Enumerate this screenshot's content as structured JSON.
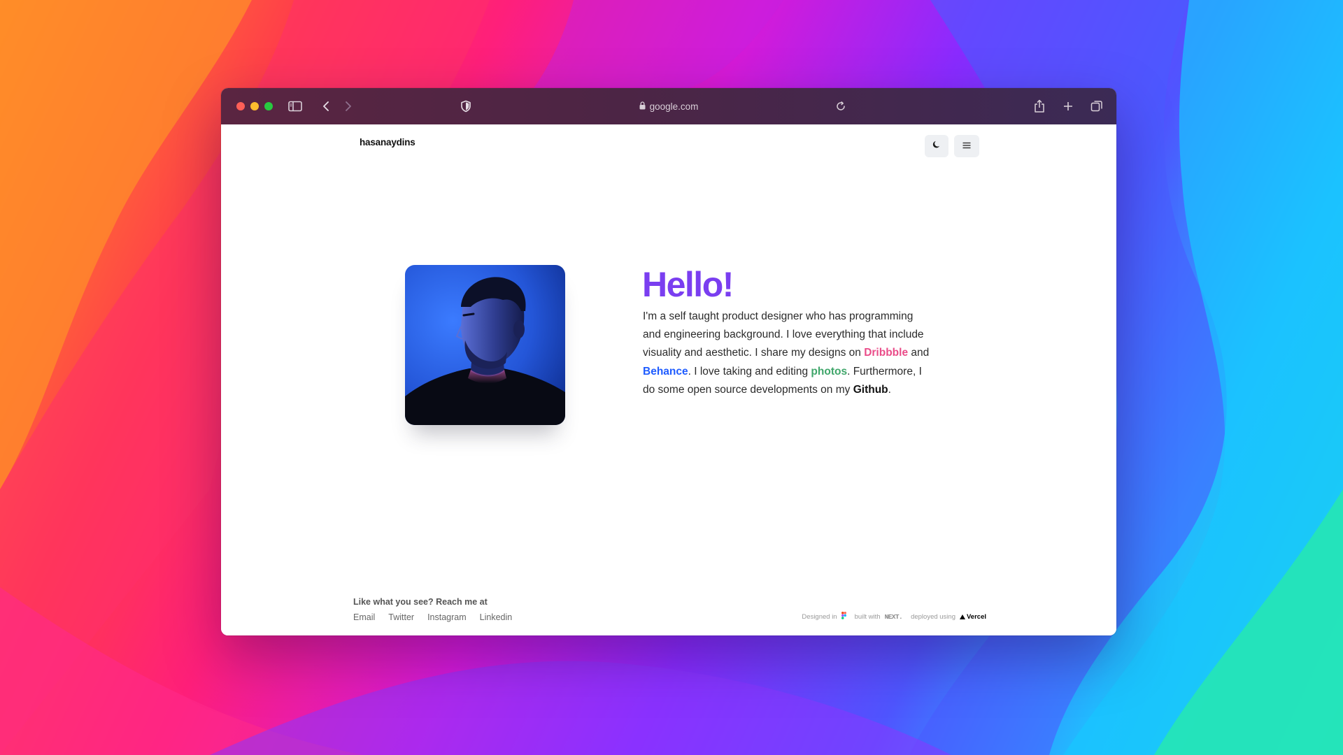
{
  "browser": {
    "url": "google.com",
    "icons": [
      "sidebar-icon",
      "back-icon",
      "forward-icon",
      "shield-icon",
      "lock-icon",
      "reload-icon",
      "share-icon",
      "new-tab-icon",
      "tabs-overview-icon"
    ]
  },
  "site": {
    "brand": "hasanaydins",
    "icons": [
      "moon-icon",
      "menu-icon"
    ],
    "hero": {
      "greeting": "Hello!",
      "bio": {
        "p1": "I'm a self taught product designer who has programming and engineering background. I love everything that include visuality and aesthetic. I share my designs on ",
        "dribbble": "Dribbble",
        "p2": " and ",
        "behance": "Behance",
        "p3": ". I love taking and editing ",
        "photos": "photos",
        "p4": ". Furthermore, I do some open source developments on my ",
        "github": "Github",
        "p5": "."
      }
    },
    "footer": {
      "reach": "Like what you see? Reach me at",
      "links": [
        "Email",
        "Twitter",
        "Instagram",
        "Linkedin"
      ],
      "credits": {
        "designed": "Designed in",
        "built": "built with",
        "next": "NEXT.",
        "deployed": "deployed using",
        "vercel": "Vercel"
      }
    }
  },
  "colors": {
    "accent": "#7a3ef0",
    "dribbble": "#ea4c89",
    "behance": "#1f5cff",
    "photos": "#3fa66a"
  }
}
